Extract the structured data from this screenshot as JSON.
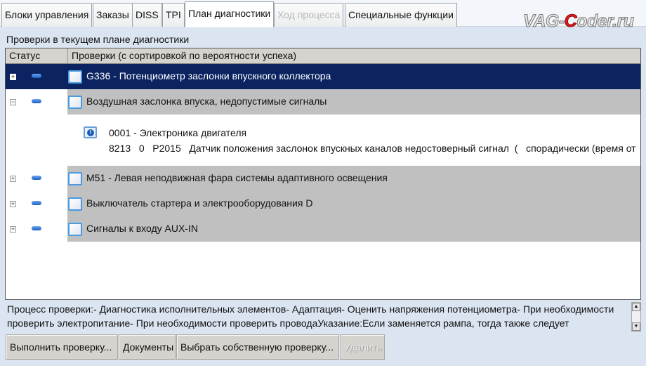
{
  "tabs": [
    {
      "label": "Блоки управления",
      "state": "normal"
    },
    {
      "label": "Заказы",
      "state": "normal"
    },
    {
      "label": "DISS",
      "state": "normal"
    },
    {
      "label": "TPI",
      "state": "normal"
    },
    {
      "label": "План диагностики",
      "state": "active"
    },
    {
      "label": "Ход процесса",
      "state": "disabled"
    },
    {
      "label": "Специальные функции",
      "state": "normal"
    }
  ],
  "watermark": {
    "part1": "VAG-",
    "part2": "C",
    "part3": "oder.ru"
  },
  "subtitle": "Проверки в текущем плане диагностики",
  "table": {
    "headers": [
      "Статус",
      "Проверки (с сортировкой по вероятности успеха)"
    ],
    "rows": [
      {
        "expander": "+",
        "text": "G336 - Потенциометр заслонки впускного коллектора",
        "selected": true
      },
      {
        "expander": "−",
        "text": "Воздушная заслонка впуска, недопустимые сигналы",
        "selected": false
      },
      {
        "expander": "+",
        "text": "M51 - Левая неподвижная фара системы адаптивного освещения",
        "selected": false
      },
      {
        "expander": "+",
        "text": "Выключатель стартера и электрооборудования D",
        "selected": false
      },
      {
        "expander": "+",
        "text": "Сигналы к входу AUX-IN",
        "selected": false
      }
    ],
    "detail": {
      "line1": "0001 - Электроника двигателя",
      "line2": "8213   0   P2015   Датчик положения заслонок впускных каналов недостоверный сигнал  (   спорадически (время от"
    }
  },
  "description": "Процесс проверки:- Диагностика исполнительных элементов- Адаптация- Оценить напряжения потенциометра- При необходимости проверить электропитание- При необходимости проверить проводаУказание:Если заменяется рампа, тогда также следует",
  "buttons": {
    "run": "Выполнить проверку...",
    "docs": "Документы",
    "choose": "Выбрать собственную проверку...",
    "delete": "Удалить"
  },
  "colors": {
    "selected_row": "#0b2461",
    "group_row": "#c0c0c0",
    "background": "#dbe5f1"
  }
}
